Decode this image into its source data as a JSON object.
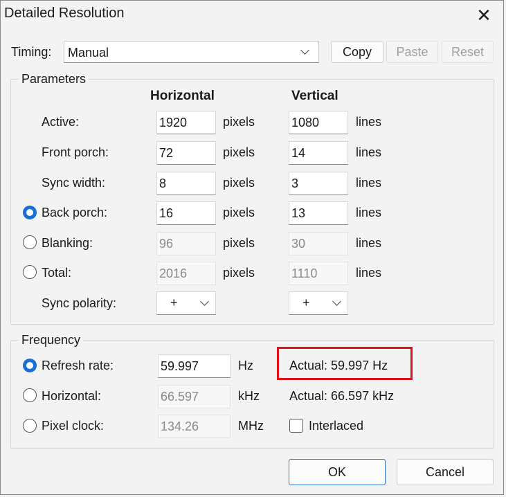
{
  "window": {
    "title": "Detailed Resolution",
    "close_icon": "close-icon"
  },
  "timing": {
    "label": "Timing:",
    "value": "Manual"
  },
  "toolbar": {
    "copy_label": "Copy",
    "paste_label": "Paste",
    "reset_label": "Reset"
  },
  "parameters": {
    "group_title": "Parameters",
    "horizontal_header": "Horizontal",
    "vertical_header": "Vertical",
    "h_unit": "pixels",
    "v_unit": "lines",
    "rows": [
      {
        "label": "Active:",
        "h": "1920",
        "v": "1080"
      },
      {
        "label": "Front porch:",
        "h": "72",
        "v": "14"
      },
      {
        "label": "Sync width:",
        "h": "8",
        "v": "3"
      },
      {
        "label": "Back porch:",
        "h": "16",
        "v": "13"
      },
      {
        "label": "Blanking:",
        "h": "96",
        "v": "30"
      },
      {
        "label": "Total:",
        "h": "2016",
        "v": "1110"
      }
    ],
    "sync_polarity": {
      "label": "Sync polarity:",
      "h": "+",
      "v": "+"
    }
  },
  "frequency": {
    "group_title": "Frequency",
    "refresh": {
      "label": "Refresh rate:",
      "value": "59.997",
      "unit": "Hz",
      "actual": "Actual: 59.997 Hz"
    },
    "horizontal": {
      "label": "Horizontal:",
      "value": "66.597",
      "unit": "kHz",
      "actual": "Actual: 66.597 kHz"
    },
    "pixel_clock": {
      "label": "Pixel clock:",
      "value": "134.26",
      "unit": "MHz"
    },
    "interlaced_label": "Interlaced"
  },
  "footer": {
    "ok_label": "OK",
    "cancel_label": "Cancel"
  },
  "colors": {
    "accent": "#1a6fd6",
    "highlight": "#e0101a"
  }
}
